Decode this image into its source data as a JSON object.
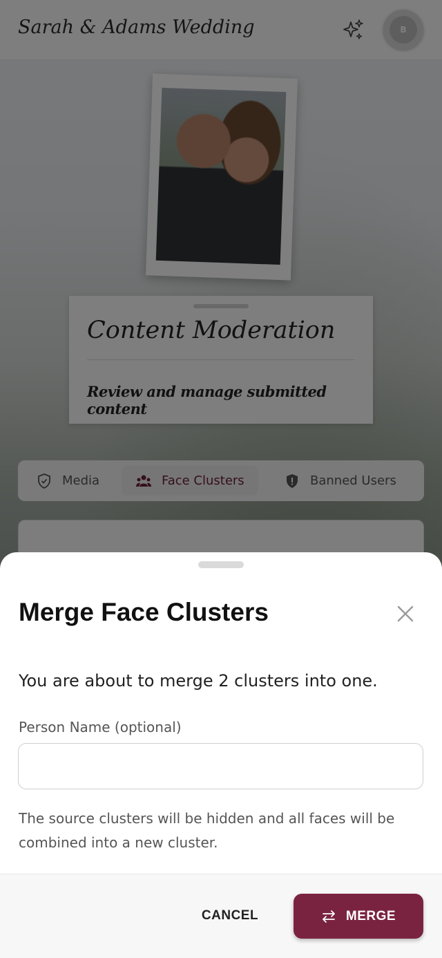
{
  "header": {
    "title": "Sarah & Adams Wedding",
    "avatar_initial": "B",
    "sparkle_icon": "sparkles-icon"
  },
  "hero": {
    "card_title": "Content Moderation",
    "card_subtitle": "Review and manage submitted content"
  },
  "tabs": [
    {
      "label": "Media",
      "icon": "shield-check-icon",
      "active": false
    },
    {
      "label": "Face Clusters",
      "icon": "people-icon",
      "active": true
    },
    {
      "label": "Banned Users",
      "icon": "shield-alert-icon",
      "active": false
    }
  ],
  "dialog": {
    "title": "Merge Face Clusters",
    "description": "You are about to merge 2 clusters into one.",
    "field_label": "Person Name (optional)",
    "field_value": "",
    "field_placeholder": "",
    "note": "The source clusters will be hidden and all faces will be combined into a new cluster.",
    "cancel_label": "CANCEL",
    "merge_label": "MERGE"
  },
  "colors": {
    "accent": "#7a2340",
    "scrim": "rgba(0,0,0,0.5)"
  }
}
